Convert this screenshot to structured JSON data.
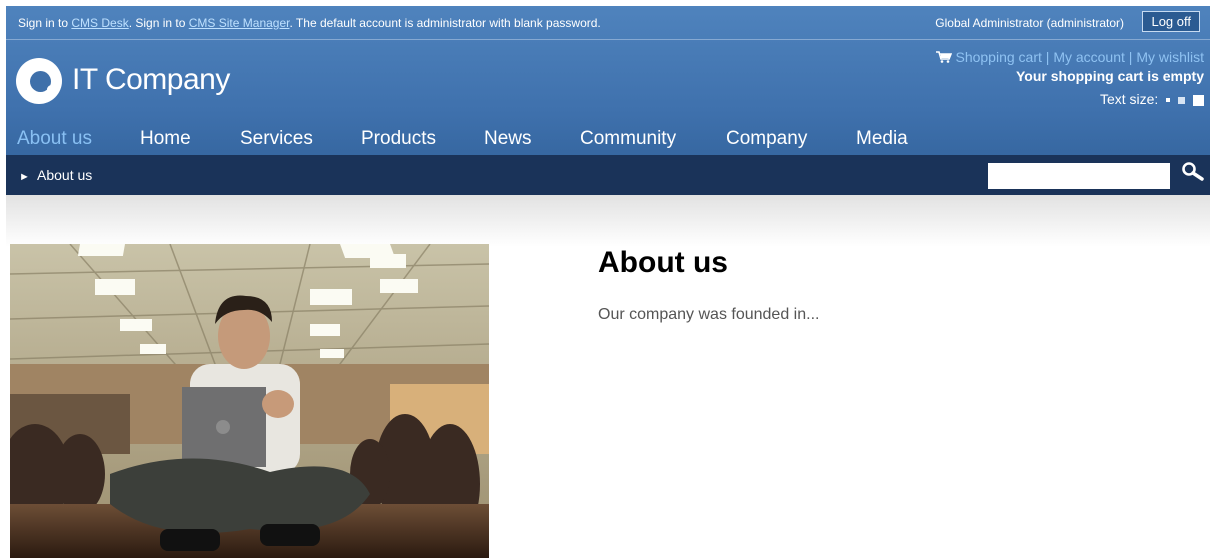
{
  "topbar": {
    "sign_in_1": "Sign in to ",
    "cms_desk": "CMS Desk",
    "sign_in_2": ". Sign in to ",
    "site_manager": "CMS Site Manager",
    "default_account": ". The default account is administrator with blank password.",
    "user": "Global Administrator (administrator)",
    "logoff": "Log off"
  },
  "logo": {
    "text": "IT Company"
  },
  "cart": {
    "shopping_cart": "Shopping cart",
    "sep": "|",
    "my_account": "My account",
    "my_wishlist": "My wishlist",
    "empty": "Your shopping cart is empty",
    "text_size": "Text size:"
  },
  "nav": {
    "items": [
      {
        "label": "About us",
        "active": true
      },
      {
        "label": "Home"
      },
      {
        "label": "Services"
      },
      {
        "label": "Products"
      },
      {
        "label": "News"
      },
      {
        "label": "Community"
      },
      {
        "label": "Company"
      },
      {
        "label": "Media"
      }
    ]
  },
  "breadcrumb": {
    "arrow": "►",
    "current": "About us"
  },
  "search": {
    "value": ""
  },
  "content": {
    "title": "About us",
    "text": "Our company was founded in..."
  },
  "colors": {
    "header_blue": "#4578b3",
    "nav_active": "#89c0f3",
    "subbar_navy": "#1a3359",
    "link_light": "#8fc2f2"
  }
}
